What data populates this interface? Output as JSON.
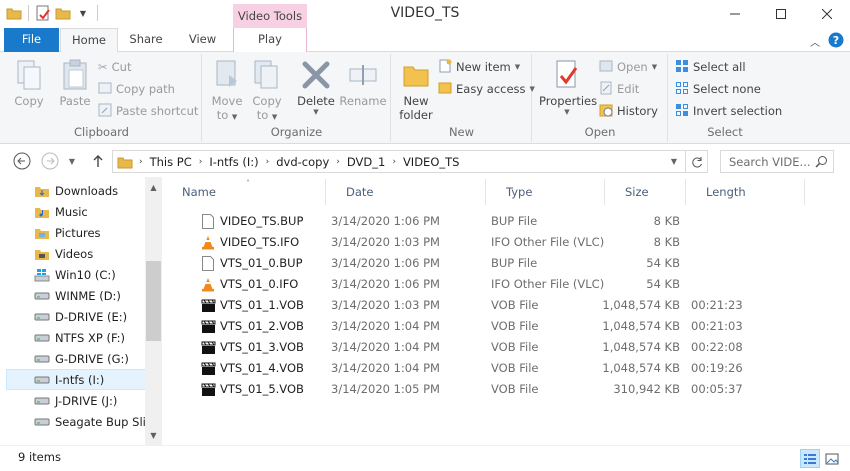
{
  "window": {
    "title": "VIDEO_TS",
    "context_tab": "Video Tools"
  },
  "tabs": {
    "file": "File",
    "home": "Home",
    "share": "Share",
    "view": "View",
    "play": "Play"
  },
  "ribbon": {
    "clipboard": {
      "label": "Clipboard",
      "copy": "Copy",
      "paste": "Paste",
      "cut": "Cut",
      "copy_path": "Copy path",
      "paste_shortcut": "Paste shortcut"
    },
    "organize": {
      "label": "Organize",
      "move_to_1": "Move",
      "move_to_2": "to",
      "copy_to_1": "Copy",
      "copy_to_2": "to",
      "delete": "Delete",
      "rename": "Rename"
    },
    "new": {
      "label": "New",
      "new_folder_1": "New",
      "new_folder_2": "folder",
      "new_item": "New item",
      "easy_access": "Easy access"
    },
    "open": {
      "label": "Open",
      "properties": "Properties",
      "open": "Open",
      "edit": "Edit",
      "history": "History"
    },
    "select": {
      "label": "Select",
      "select_all": "Select all",
      "select_none": "Select none",
      "invert": "Invert selection"
    }
  },
  "address": {
    "crumbs": [
      "This PC",
      "I-ntfs (I:)",
      "dvd-copy",
      "DVD_1",
      "VIDEO_TS"
    ],
    "search_placeholder": "Search VIDE..."
  },
  "nav": {
    "items": [
      {
        "label": "Downloads",
        "icon": "downloads-folder-icon"
      },
      {
        "label": "Music",
        "icon": "music-folder-icon"
      },
      {
        "label": "Pictures",
        "icon": "pictures-folder-icon"
      },
      {
        "label": "Videos",
        "icon": "videos-folder-icon"
      },
      {
        "label": "Win10 (C:)",
        "icon": "windows-drive-icon"
      },
      {
        "label": "WINME (D:)",
        "icon": "drive-icon"
      },
      {
        "label": "D-DRIVE (E:)",
        "icon": "drive-icon"
      },
      {
        "label": "NTFS XP (F:)",
        "icon": "drive-icon"
      },
      {
        "label": "G-DRIVE (G:)",
        "icon": "drive-icon"
      },
      {
        "label": "I-ntfs (I:)",
        "icon": "drive-icon"
      },
      {
        "label": "J-DRIVE (J:)",
        "icon": "drive-icon"
      },
      {
        "label": "Seagate Bup Slim",
        "icon": "drive-icon"
      }
    ]
  },
  "columns": {
    "name": "Name",
    "date": "Date",
    "type": "Type",
    "size": "Size",
    "length": "Length"
  },
  "files": [
    {
      "name": "VIDEO_TS.BUP",
      "date": "3/14/2020 1:06 PM",
      "type": "BUP File",
      "size": "8 KB",
      "length": "",
      "icon": "blank-file-icon"
    },
    {
      "name": "VIDEO_TS.IFO",
      "date": "3/14/2020 1:03 PM",
      "type": "IFO Other File (VLC)",
      "size": "8 KB",
      "length": "",
      "icon": "vlc-cone-icon"
    },
    {
      "name": "VTS_01_0.BUP",
      "date": "3/14/2020 1:06 PM",
      "type": "BUP File",
      "size": "54 KB",
      "length": "",
      "icon": "blank-file-icon"
    },
    {
      "name": "VTS_01_0.IFO",
      "date": "3/14/2020 1:06 PM",
      "type": "IFO Other File (VLC)",
      "size": "54 KB",
      "length": "",
      "icon": "vlc-cone-icon"
    },
    {
      "name": "VTS_01_1.VOB",
      "date": "3/14/2020 1:03 PM",
      "type": "VOB File",
      "size": "1,048,574 KB",
      "length": "00:21:23",
      "icon": "clapperboard-icon"
    },
    {
      "name": "VTS_01_2.VOB",
      "date": "3/14/2020 1:04 PM",
      "type": "VOB File",
      "size": "1,048,574 KB",
      "length": "00:21:03",
      "icon": "clapperboard-icon"
    },
    {
      "name": "VTS_01_3.VOB",
      "date": "3/14/2020 1:04 PM",
      "type": "VOB File",
      "size": "1,048,574 KB",
      "length": "00:22:08",
      "icon": "clapperboard-icon"
    },
    {
      "name": "VTS_01_4.VOB",
      "date": "3/14/2020 1:04 PM",
      "type": "VOB File",
      "size": "1,048,574 KB",
      "length": "00:19:26",
      "icon": "clapperboard-icon"
    },
    {
      "name": "VTS_01_5.VOB",
      "date": "3/14/2020 1:05 PM",
      "type": "VOB File",
      "size": "310,942 KB",
      "length": "00:05:37",
      "icon": "clapperboard-icon"
    }
  ],
  "status": {
    "count": "9 items"
  },
  "colors": {
    "file_tab": "#1979ca",
    "context_tab": "#f7d0e4",
    "header_text": "#4c607a",
    "selected_nav": "#e5f3ff"
  }
}
